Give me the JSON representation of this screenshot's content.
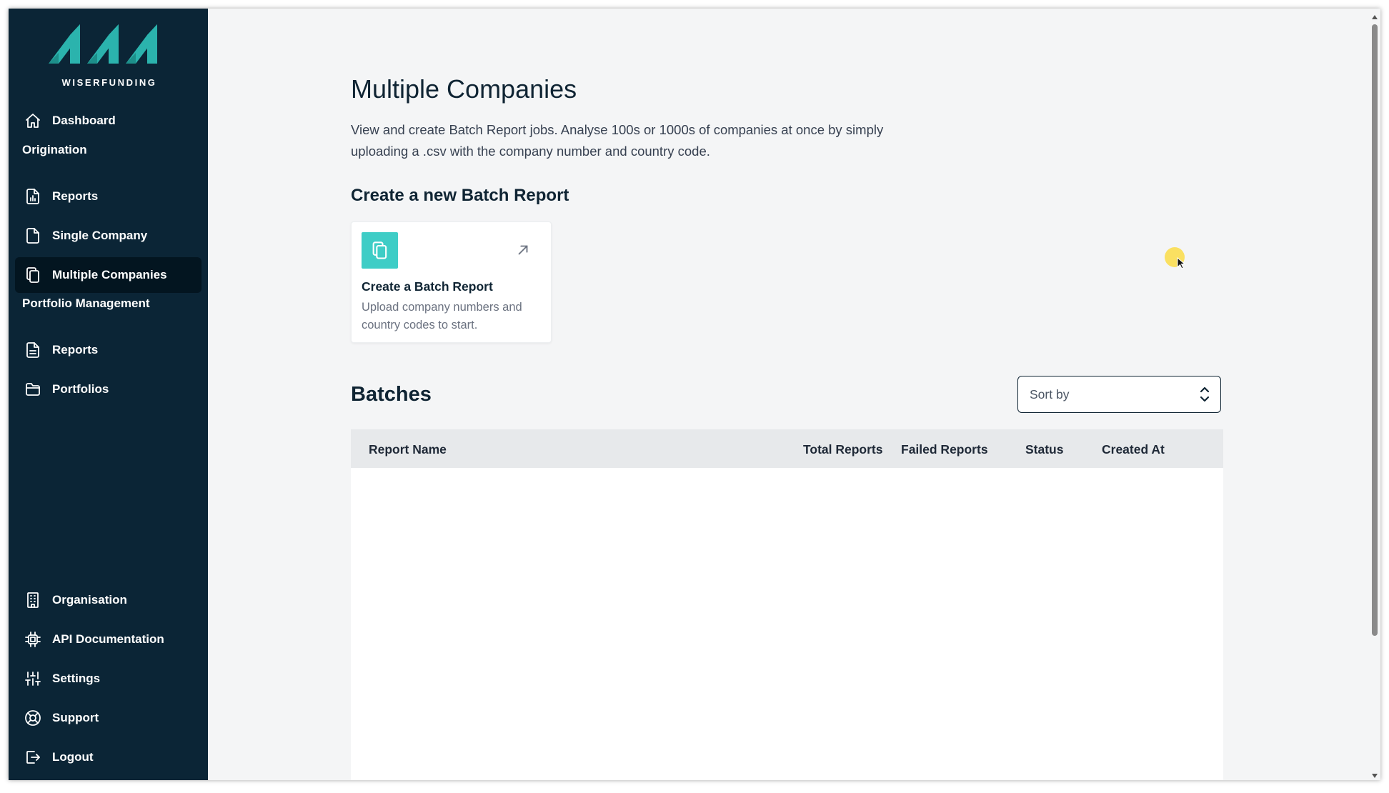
{
  "brand": {
    "name": "WISERFUNDING",
    "logo_color": "#2bb3ad"
  },
  "sidebar": {
    "top_items": [
      {
        "label": "Dashboard",
        "icon": "home-icon"
      }
    ],
    "sections": {
      "origination": "Origination",
      "portfolio_management": "Portfolio Management"
    },
    "origination_items": [
      {
        "label": "Reports",
        "icon": "chart-document-icon"
      },
      {
        "label": "Single Company",
        "icon": "document-icon"
      },
      {
        "label": "Multiple Companies",
        "icon": "documents-icon",
        "active": true
      }
    ],
    "portfolio_items": [
      {
        "label": "Reports",
        "icon": "text-document-icon"
      },
      {
        "label": "Portfolios",
        "icon": "folder-icon"
      }
    ],
    "bottom_items": [
      {
        "label": "Organisation",
        "icon": "building-icon"
      },
      {
        "label": "API Documentation",
        "icon": "chip-icon"
      },
      {
        "label": "Settings",
        "icon": "sliders-icon"
      },
      {
        "label": "Support",
        "icon": "lifebuoy-icon"
      },
      {
        "label": "Logout",
        "icon": "logout-icon"
      }
    ]
  },
  "main": {
    "title": "Multiple Companies",
    "description": "View and create Batch Report jobs. Analyse 100s or 1000s of companies at once by simply uploading a .csv with the company number and country code.",
    "create_heading": "Create a new Batch Report",
    "card": {
      "title": "Create a Batch Report",
      "description": "Upload company numbers and country codes to start.",
      "icon": "documents-icon",
      "icon_bg": "#3ecdc6",
      "arrow_icon": "arrow-up-right-icon"
    },
    "batches_heading": "Batches",
    "sort": {
      "placeholder": "Sort by"
    },
    "table": {
      "columns": [
        "Report Name",
        "Total Reports",
        "Failed Reports",
        "Status",
        "Created At"
      ],
      "rows": []
    }
  },
  "colors": {
    "sidebar_bg": "#0b2536",
    "active_item_bg": "#031520",
    "accent": "#3ecdc6",
    "page_bg": "#f4f5f6"
  }
}
